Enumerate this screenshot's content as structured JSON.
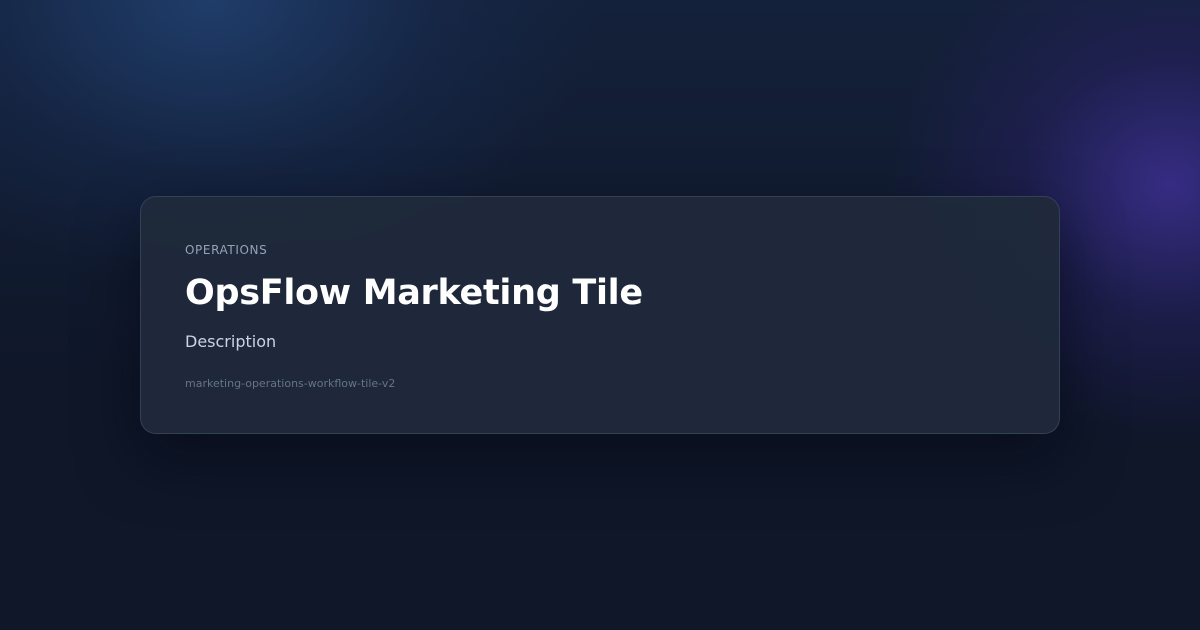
{
  "tile": {
    "category": "OPERATIONS",
    "title": "OpsFlow Marketing Tile",
    "description": "Description",
    "slug": "marketing-operations-workflow-tile-v2"
  },
  "colors": {
    "background": "#0f1729",
    "card": "#1f293b",
    "title": "#ffffff",
    "eyebrow": "#94a3b8",
    "description": "#cbd5e1",
    "slug": "#64748b",
    "glow_blue": "#214272",
    "glow_purple": "#3a2e8c"
  }
}
